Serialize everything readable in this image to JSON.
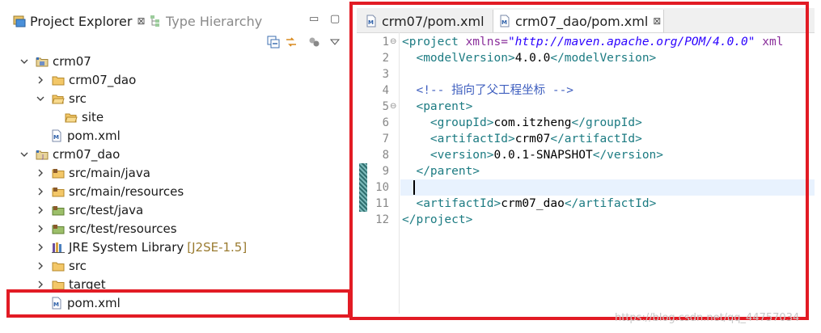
{
  "explorer": {
    "tabs": [
      {
        "label": "Project Explorer",
        "close": "⊠"
      },
      {
        "label": "Type Hierarchy"
      }
    ],
    "window_buttons": [
      "▭",
      "▢"
    ],
    "tree": [
      {
        "label": "crm07"
      },
      {
        "label": "crm07_dao"
      },
      {
        "label": "src"
      },
      {
        "label": "site"
      },
      {
        "label": "pom.xml"
      },
      {
        "label": "crm07_dao"
      },
      {
        "label": "src/main/java"
      },
      {
        "label": "src/main/resources"
      },
      {
        "label": "src/test/java"
      },
      {
        "label": "src/test/resources"
      },
      {
        "label": "JRE System Library",
        "decoration": "[J2SE-1.5]"
      },
      {
        "label": "src"
      },
      {
        "label": "target"
      },
      {
        "label": "pom.xml"
      }
    ]
  },
  "editor": {
    "tabs": [
      {
        "label": "crm07/pom.xml"
      },
      {
        "label": "crm07_dao/pom.xml",
        "close": "⊠"
      }
    ],
    "line_numbers": [
      "1",
      "2",
      "3",
      "4",
      "5",
      "6",
      "7",
      "8",
      "9",
      "10",
      "11",
      "12"
    ],
    "code": {
      "l1_tag": "<project",
      "l1_attr": " xmlns=",
      "l1_str": "\"http://maven.apache.org/POM/4.0.0\"",
      "l1_attr2": " xml",
      "l2_open": "<modelVersion>",
      "l2_text": "4.0.0",
      "l2_close": "</modelVersion>",
      "l4_comment": "<!-- 指向了父工程坐标 -->",
      "l5_tag": "<parent>",
      "l6_open": "<groupId>",
      "l6_text": "com.itzheng",
      "l6_close": "</groupId>",
      "l7_open": "<artifactId>",
      "l7_text": "crm07",
      "l7_close": "</artifactId>",
      "l8_open": "<version>",
      "l8_text": "0.0.1-SNAPSHOT",
      "l8_close": "</version>",
      "l9_tag": "</parent>",
      "l11_open": "<artifactId>",
      "l11_text": "crm07_dao",
      "l11_close": "</artifactId>",
      "l12_tag": "</project>"
    }
  },
  "watermark": "https://blog.csdn.net/qq_44757034",
  "colors": {
    "highlight": "#e21b24",
    "tag": "#1c7b82",
    "attribute": "#8a2f9b",
    "string": "#2a00ff",
    "comment": "#3f5fbf"
  }
}
